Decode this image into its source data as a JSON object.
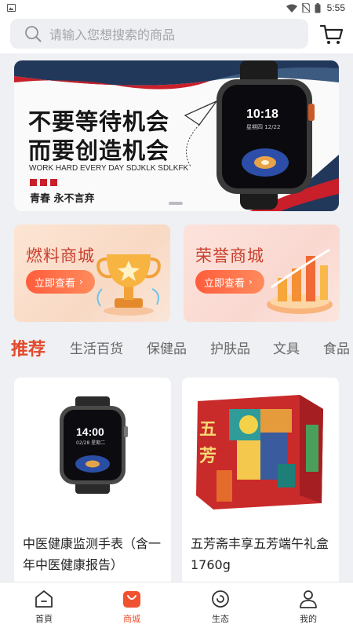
{
  "status_bar": {
    "time": "5:55"
  },
  "search": {
    "placeholder": "请输入您想搜索的商品"
  },
  "banner": {
    "title_line1": "不要等待机会",
    "title_line2": "而要创造机会",
    "subtitle": "WORK HARD EVERY DAY SDJKLK SDLKFK",
    "slogan": "青春 永不言弃",
    "watch_time": "10:18",
    "watch_date": "星期四 12/22"
  },
  "promos": [
    {
      "title": "燃料商城",
      "button": "立即查看"
    },
    {
      "title": "荣誉商城",
      "button": "立即查看"
    }
  ],
  "category_tabs": [
    "推荐",
    "生活百货",
    "保健品",
    "护肤品",
    "文具",
    "食品"
  ],
  "products": [
    {
      "name": "中医健康监测手表（含一年中医健康报告）",
      "watch_time": "14:00",
      "watch_date": "02/28 星期二"
    },
    {
      "name": "五芳斋丰享五芳端午礼盒1760g",
      "box_text": "五芳"
    }
  ],
  "bottom_nav": [
    {
      "label": "首頁",
      "icon": "home-icon"
    },
    {
      "label": "商城",
      "icon": "shopping-bag-icon",
      "active": true
    },
    {
      "label": "生态",
      "icon": "ecology-icon"
    },
    {
      "label": "我的",
      "icon": "user-icon"
    }
  ],
  "colors": {
    "accent": "#e2482b",
    "nav_active": "#f0522f",
    "banner_red": "#c81f2a"
  }
}
